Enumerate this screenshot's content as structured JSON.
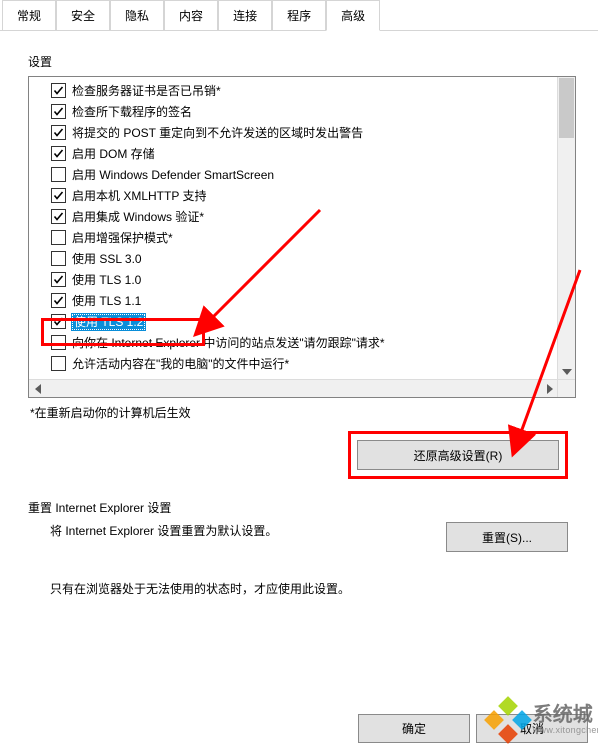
{
  "tabs": {
    "items": [
      {
        "label": "常规"
      },
      {
        "label": "安全"
      },
      {
        "label": "隐私"
      },
      {
        "label": "内容"
      },
      {
        "label": "连接"
      },
      {
        "label": "程序"
      },
      {
        "label": "高级"
      }
    ],
    "active_index": 6
  },
  "settings": {
    "heading": "设置",
    "options": [
      {
        "checked": true,
        "label": "检查服务器证书是否已吊销*"
      },
      {
        "checked": true,
        "label": "检查所下载程序的签名"
      },
      {
        "checked": true,
        "label": "将提交的 POST 重定向到不允许发送的区域时发出警告"
      },
      {
        "checked": true,
        "label": "启用 DOM 存储"
      },
      {
        "checked": false,
        "label": "启用 Windows Defender SmartScreen"
      },
      {
        "checked": true,
        "label": "启用本机 XMLHTTP 支持"
      },
      {
        "checked": true,
        "label": "启用集成 Windows 验证*"
      },
      {
        "checked": false,
        "label": "启用增强保护模式*"
      },
      {
        "checked": false,
        "label": "使用 SSL 3.0"
      },
      {
        "checked": true,
        "label": "使用 TLS 1.0"
      },
      {
        "checked": true,
        "label": "使用 TLS 1.1"
      },
      {
        "checked": true,
        "label": "使用 TLS 1.2",
        "highlight": true
      },
      {
        "checked": false,
        "label": "向你在 Internet Explorer 中访问的站点发送\"请勿跟踪\"请求*"
      },
      {
        "checked": false,
        "label": "允许活动内容在\"我的电脑\"的文件中运行*"
      }
    ],
    "note": "*在重新启动你的计算机后生效",
    "restore_button": "还原高级设置(R)"
  },
  "reset": {
    "heading": "重置 Internet Explorer 设置",
    "desc": "将 Internet Explorer 设置重置为默认设置。",
    "button": "重置(S)...",
    "info": "只有在浏览器处于无法使用的状态时，才应使用此设置。"
  },
  "footer": {
    "ok": "确定",
    "cancel": "取消"
  },
  "watermark": {
    "title": "系统城",
    "url": "www.xitongcheng.com"
  }
}
